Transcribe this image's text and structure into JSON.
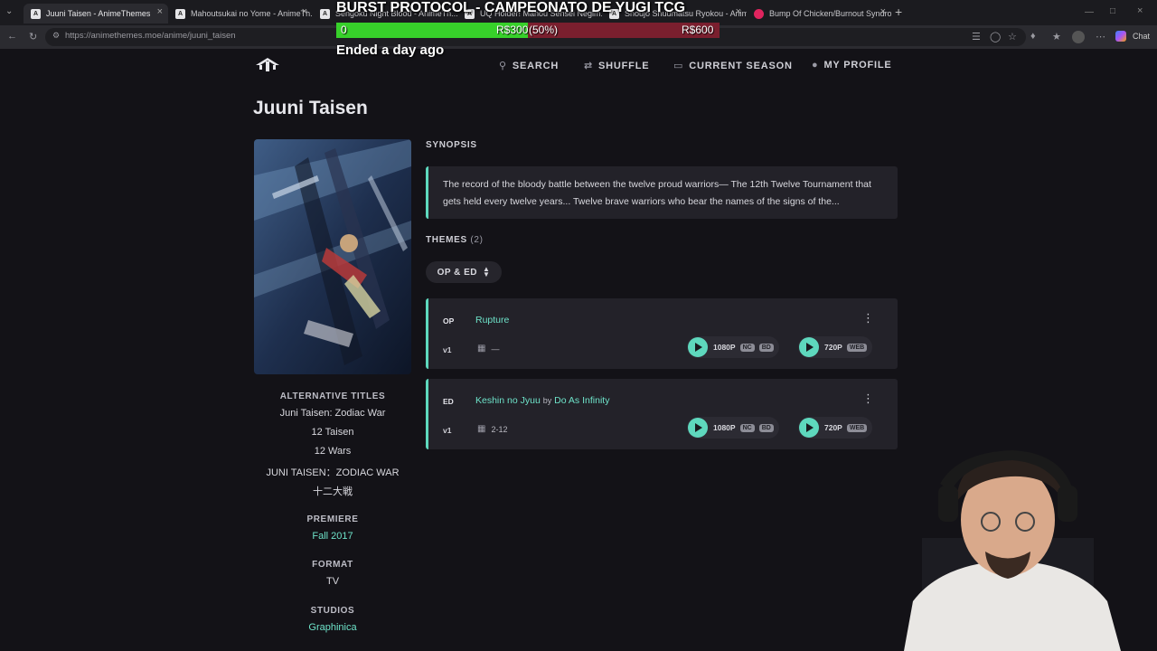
{
  "browser": {
    "tabs": [
      {
        "label": "Juuni Taisen - AnimeThemes",
        "active": true
      },
      {
        "label": "Mahoutsukai no Yome - AnimeTh..."
      },
      {
        "label": "Sengoku Night Blood - AnimeTh..."
      },
      {
        "label": "UQ Holder! Mahou Sensei Negim..."
      },
      {
        "label": "Shoujo Shuumatsu Ryokou - Anim..."
      },
      {
        "label": "Bump Of Chicken/Burnout Syndro..."
      }
    ],
    "url": "https://animethemes.moe/anime/juuni_taisen",
    "chat_label": "Chat"
  },
  "overlay": {
    "title": "BURST PROTOCOL - CAMPEONATO DE YUGI TCG",
    "start": "0",
    "current": "R$300",
    "percent": "(50%)",
    "goal": "R$600",
    "progress": 0.5,
    "status": "Ended a day ago"
  },
  "nav": {
    "search": "SEARCH",
    "shuffle": "SHUFFLE",
    "current_season": "CURRENT SEASON",
    "my_profile": "MY PROFILE"
  },
  "anime": {
    "title": "Juuni Taisen",
    "alt_titles_label": "ALTERNATIVE TITLES",
    "alt_titles": [
      "Juni Taisen: Zodiac War",
      "12 Taisen",
      "12 Wars",
      "JUNI TAISEN：ZODIAC WAR",
      "十二大戦"
    ],
    "premiere_label": "PREMIERE",
    "premiere": "Fall 2017",
    "format_label": "FORMAT",
    "format": "TV",
    "studios_label": "STUDIOS",
    "studio": "Graphinica"
  },
  "synopsis": {
    "label": "SYNOPSIS",
    "text": "The record of the bloody battle between the twelve proud warriors— The 12th Twelve Tournament that gets held every twelve years... Twelve brave warriors who bear the names of the signs of the..."
  },
  "themes": {
    "label": "THEMES",
    "count": "(2)",
    "filter": "OP & ED",
    "items": [
      {
        "type": "OP",
        "song": "Rupture",
        "by_label": "",
        "artist": "",
        "version": "v1",
        "episodes": "—",
        "videos": [
          {
            "res": "1080P",
            "tags": [
              "NC",
              "BD"
            ]
          },
          {
            "res": "720P",
            "tags": [
              "WEB"
            ]
          }
        ]
      },
      {
        "type": "ED",
        "song": "Keshin no Jyuu",
        "by_label": "by",
        "artist": "Do As Infinity",
        "version": "v1",
        "episodes": "2-12",
        "videos": [
          {
            "res": "1080P",
            "tags": [
              "NC",
              "BD"
            ]
          },
          {
            "res": "720P",
            "tags": [
              "WEB"
            ]
          }
        ]
      }
    ]
  },
  "colors": {
    "accent": "#5ed8bd",
    "link": "#6ee3c9",
    "page_bg": "#131217",
    "card_bg": "#232229"
  }
}
